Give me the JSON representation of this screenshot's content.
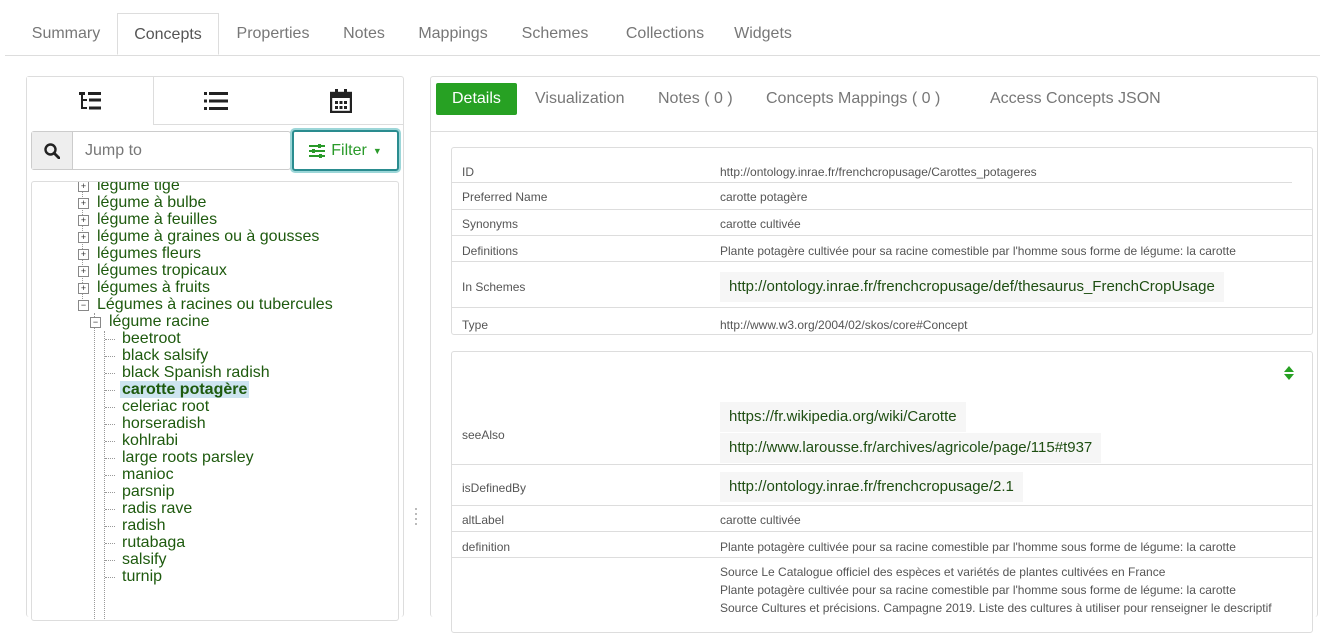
{
  "top_tabs": [
    {
      "label": "Summary"
    },
    {
      "label": "Concepts"
    },
    {
      "label": "Properties"
    },
    {
      "label": "Notes"
    },
    {
      "label": "Mappings"
    },
    {
      "label": "Schemes"
    },
    {
      "label": "Collections"
    },
    {
      "label": "Widgets"
    }
  ],
  "active_top_tab": "Concepts",
  "left": {
    "view_tabs": [
      "tree-view-icon",
      "list-view-icon",
      "calendar-icon"
    ],
    "jump_placeholder": "Jump to",
    "filter_label": "Filter",
    "tree": [
      {
        "label": "légume tige",
        "expander": "+"
      },
      {
        "label": "légume à bulbe",
        "expander": "+"
      },
      {
        "label": "légume à feuilles",
        "expander": "+"
      },
      {
        "label": "légume à graines ou à gousses",
        "expander": "+"
      },
      {
        "label": "légumes fleurs",
        "expander": "+"
      },
      {
        "label": "légumes tropicaux",
        "expander": "+"
      },
      {
        "label": "légumes à fruits",
        "expander": "+"
      },
      {
        "label": "Légumes à racines ou tubercules",
        "expander": "−"
      },
      {
        "label": "légume racine",
        "expander": "−"
      },
      {
        "label": "beetroot"
      },
      {
        "label": "black salsify"
      },
      {
        "label": "black Spanish radish"
      },
      {
        "label": "carotte potagère",
        "selected": true
      },
      {
        "label": "celeriac root"
      },
      {
        "label": "horseradish"
      },
      {
        "label": "kohlrabi"
      },
      {
        "label": "large roots parsley"
      },
      {
        "label": "manioc"
      },
      {
        "label": "parsnip"
      },
      {
        "label": "radis rave"
      },
      {
        "label": "radish"
      },
      {
        "label": "rutabaga"
      },
      {
        "label": "salsify"
      },
      {
        "label": "turnip"
      }
    ]
  },
  "right": {
    "tabs": [
      "Details",
      "Visualization",
      "Notes ( 0 )",
      "Concepts Mappings ( 0 )",
      "Access Concepts JSON"
    ],
    "details": {
      "id_label": "ID",
      "id": "http://ontology.inrae.fr/frenchcropusage/Carottes_potageres",
      "pref_label": "Preferred Name",
      "pref": "carotte potagère",
      "syn_label": "Synonyms",
      "syn": "carotte cultivée",
      "def_label": "Definitions",
      "def": "Plante potagère cultivée pour sa racine comestible par l'homme sous forme de légume: la carotte",
      "schemes_label": "In Schemes",
      "schemes": "http://ontology.inrae.fr/frenchcropusage/def/thesaurus_FrenchCropUsage",
      "type_label": "Type",
      "type": "http://www.w3.org/2004/02/skos/core#Concept"
    },
    "properties": {
      "seealso_label": "seeAlso",
      "seealso": [
        "https://fr.wikipedia.org/wiki/Carotte",
        "http://www.larousse.fr/archives/agricole/page/115#t937"
      ],
      "definedby_label": "isDefinedBy",
      "definedby": "http://ontology.inrae.fr/frenchcropusage/2.1",
      "altlabel_label": "altLabel",
      "altlabel": "carotte cultivée",
      "definition_label": "definition",
      "definition": "Plante potagère cultivée pour sa racine comestible par l'homme sous forme de légume: la carotte",
      "source_lines": [
        "Source Le Catalogue officiel des espèces et variétés de plantes cultivées en France",
        "Plante potagère cultivée pour sa racine comestible par l'homme sous forme de légume: la carotte",
        "Source Cultures et précisions. Campagne 2019. Liste des cultures à utiliser pour renseigner le descriptif"
      ]
    }
  },
  "colors": {
    "accent": "#27a123",
    "link": "#1e4e12",
    "tree_text": "#1e5a0e",
    "selected_bg": "#cde4f0"
  }
}
